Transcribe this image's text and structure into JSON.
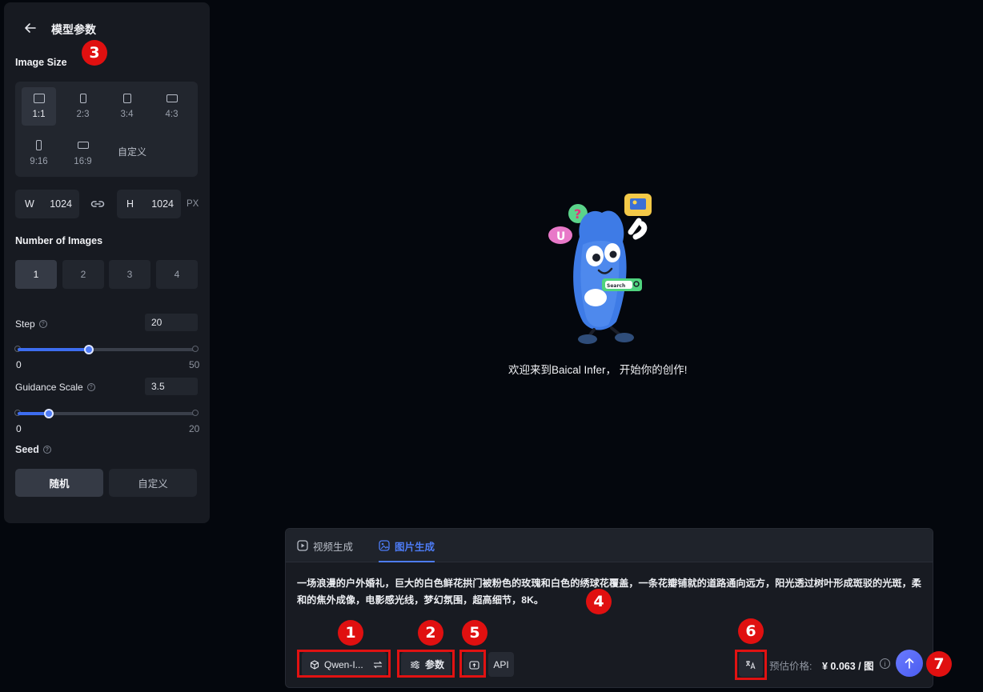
{
  "panel": {
    "title": "模型参数",
    "image_size_label": "Image Size",
    "ratios": [
      {
        "label": "1:1",
        "active": true
      },
      {
        "label": "2:3",
        "active": false
      },
      {
        "label": "3:4",
        "active": false
      },
      {
        "label": "4:3",
        "active": false
      },
      {
        "label": "9:16",
        "active": false
      },
      {
        "label": "16:9",
        "active": false
      }
    ],
    "custom_ratio_label": "自定义",
    "width_key": "W",
    "width_value": "1024",
    "height_key": "H",
    "height_value": "1024",
    "unit": "PX",
    "num_images_label": "Number of Images",
    "num_options": [
      "1",
      "2",
      "3",
      "4"
    ],
    "num_selected": "1",
    "step": {
      "label": "Step",
      "value": "20",
      "min": "0",
      "max": "50",
      "fraction": 0.4
    },
    "guidance": {
      "label": "Guidance Scale",
      "value": "3.5",
      "min": "0",
      "max": "20",
      "fraction": 0.175
    },
    "seed_label": "Seed",
    "seed_random": "随机",
    "seed_custom": "自定义"
  },
  "welcome": {
    "text": "欢迎来到Baical Infer，  开始你的创作!",
    "mascot_bubble_text": "Search",
    "mascot_u": "U",
    "mascot_q": "?"
  },
  "composer": {
    "tab_video": "视频生成",
    "tab_image": "图片生成",
    "prompt": "一场浪漫的户外婚礼，巨大的白色鲜花拱门被粉色的玫瑰和白色的绣球花覆盖，一条花瓣铺就的道路通向远方，阳光透过树叶形成斑驳的光斑，柔和的焦外成像，电影感光线，梦幻氛围，超高细节，8K。",
    "model_label": "Qwen-I...",
    "params_label": "参数",
    "api_label": "API",
    "price_label": "预估价格:",
    "price_value": "¥ 0.063 / 图",
    "info_glyph": "i"
  },
  "badges": [
    "1",
    "2",
    "3",
    "4",
    "5",
    "6",
    "7"
  ],
  "colors": {
    "accent": "#4d7cf6",
    "annotation": "#e01010",
    "panel_bg": "#171a21"
  }
}
